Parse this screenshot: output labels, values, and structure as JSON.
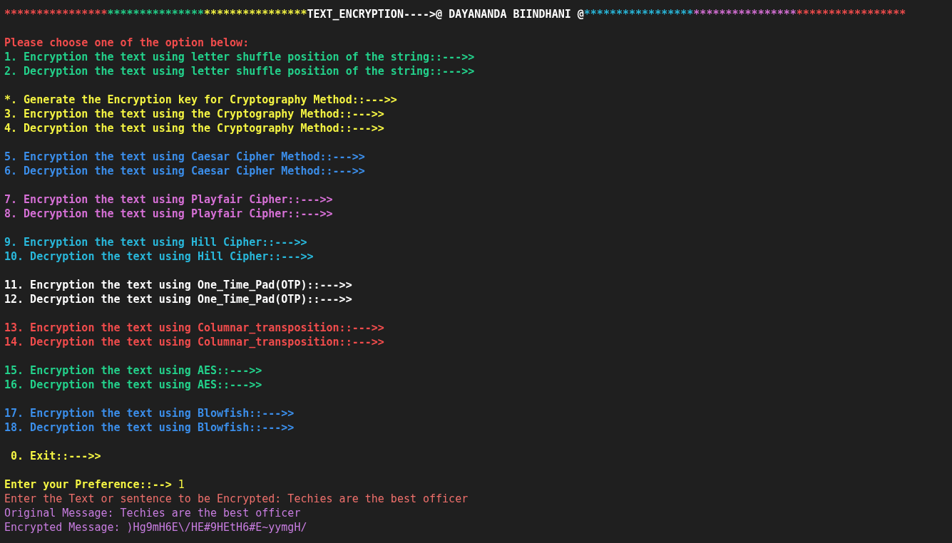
{
  "banner": {
    "left_stars": "***********************************************",
    "left_runs": [
      {
        "color": "#f14c4c"
      },
      {
        "color": "#23d18b"
      },
      {
        "color": "#f5f543"
      }
    ],
    "title": "TEXT_ENCRYPTION---->@ DAYANANDA BIINDHANI @",
    "right_stars": "**************************************************",
    "right_runs": [
      {
        "color": "#29b8db"
      },
      {
        "color": "#d670d6"
      },
      {
        "color": "#f14c4c"
      }
    ]
  },
  "heading": {
    "text": "Please choose one of the option below:",
    "color": "#f14c4c"
  },
  "menu_groups": [
    {
      "items": [
        {
          "text": "1. Encryption the text using letter shuffle position of the string::--->>",
          "color": "#23d18b"
        },
        {
          "text": "2. Decryption the text using letter shuffle position of the string::--->>",
          "color": "#23d18b"
        }
      ]
    },
    {
      "items": [
        {
          "text": "*. Generate the Encryption key for Cryptography Method::--->>",
          "color": "#f5f543"
        },
        {
          "text": "3. Encryption the text using the Cryptography Method::--->>",
          "color": "#f5f543"
        },
        {
          "text": "4. Decryption the text using the Cryptography Method::--->>",
          "color": "#f5f543"
        }
      ]
    },
    {
      "items": [
        {
          "text": "5. Encryption the text using Caesar Cipher Method::--->>",
          "color": "#3b8eea"
        },
        {
          "text": "6. Decryption the text using Caesar Cipher Method::--->>",
          "color": "#3b8eea"
        }
      ]
    },
    {
      "items": [
        {
          "text": "7. Encryption the text using Playfair Cipher::--->>",
          "color": "#d670d6"
        },
        {
          "text": "8. Decryption the text using Playfair Cipher::--->>",
          "color": "#d670d6"
        }
      ]
    },
    {
      "items": [
        {
          "text": "9. Encryption the text using Hill Cipher::--->>",
          "color": "#29b8db"
        },
        {
          "text": "10. Decryption the text using Hill Cipher::--->>",
          "color": "#29b8db"
        }
      ]
    },
    {
      "items": [
        {
          "text": "11. Encryption the text using One_Time_Pad(OTP)::--->>",
          "color": "#ffffff"
        },
        {
          "text": "12. Decryption the text using One_Time_Pad(OTP)::--->>",
          "color": "#ffffff"
        }
      ]
    },
    {
      "items": [
        {
          "text": "13. Encryption the text using Columnar_transposition::--->>",
          "color": "#f14c4c"
        },
        {
          "text": "14. Decryption the text using Columnar_transposition::--->>",
          "color": "#f14c4c"
        }
      ]
    },
    {
      "items": [
        {
          "text": "15. Encryption the text using AES::--->>",
          "color": "#23d18b"
        },
        {
          "text": "16. Decryption the text using AES::--->>",
          "color": "#23d18b"
        }
      ]
    },
    {
      "items": [
        {
          "text": "17. Encryption the text using Blowfish::--->>",
          "color": "#3b8eea"
        },
        {
          "text": "18. Decryption the text using Blowfish::--->>",
          "color": "#3b8eea"
        }
      ]
    },
    {
      "items": [
        {
          "text": " 0. Exit::--->>",
          "color": "#f5f543"
        }
      ]
    }
  ],
  "prompt": {
    "label": "Enter your Preference::-->",
    "value": "1",
    "color": "#f5f543"
  },
  "output": [
    {
      "text": "Enter the Text or sentence to be Encrypted: Techies are the best officer",
      "color": "#f0706c"
    },
    {
      "text": "Original Message: Techies are the best officer",
      "color": "#c87de0"
    },
    {
      "text": "Encrypted Message: )Hg9mH6E\\/HE#9HEtH6#E~yymgH/",
      "color": "#c87de0"
    }
  ]
}
